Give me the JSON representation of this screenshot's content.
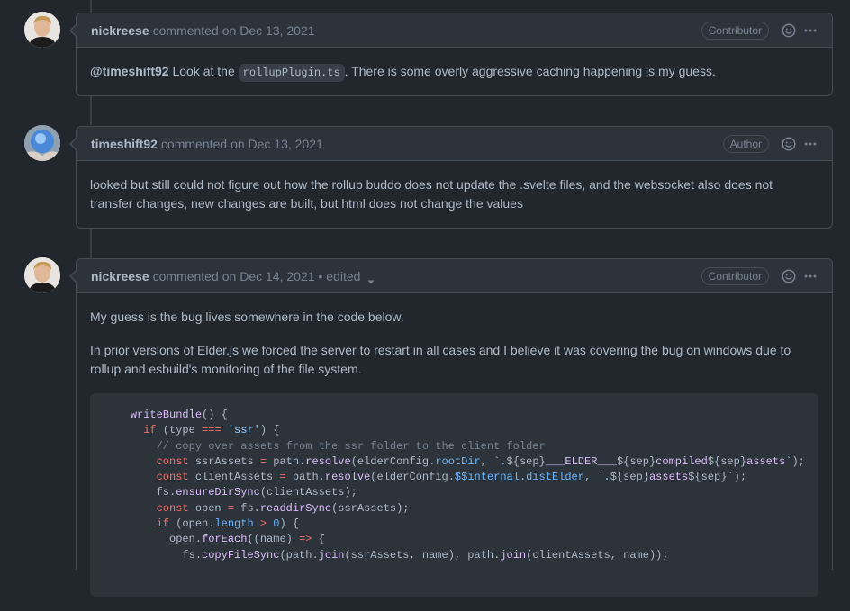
{
  "comments": [
    {
      "author": "nickreese",
      "action": "commented",
      "date": "on Dec 13, 2021",
      "badge": "Contributor",
      "body": {
        "mention": "@timeshift92",
        "text_before_code": " Look at the ",
        "code": "rollupPlugin.ts",
        "text_after_code": ". There is some overly aggressive caching happening is my guess."
      }
    },
    {
      "author": "timeshift92",
      "action": "commented",
      "date": "on Dec 13, 2021",
      "badge": "Author",
      "body": {
        "text": "looked but still could not figure out how the rollup buddo does not update the .svelte files, and the websocket also does not transfer changes, new changes are built, but html does not change the values"
      }
    },
    {
      "author": "nickreese",
      "action": "commented",
      "date": "on Dec 14, 2021",
      "edited": "• edited",
      "badge": "Contributor",
      "body": {
        "p1": "My guess is the bug lives somewhere in the code below.",
        "p2": "In prior versions of Elder.js we forced the server to restart in all cases and I believe it was covering the bug on windows due to rollup and esbuild's monitoring of the file system."
      }
    }
  ],
  "code_lines": [
    "    writeBundle() {",
    "      if (type === 'ssr') {",
    "        // copy over assets from the ssr folder to the client folder",
    "        const ssrAssets = path.resolve(elderConfig.rootDir, `.${sep}___ELDER___${sep}compiled${sep}assets`);",
    "        const clientAssets = path.resolve(elderConfig.$$internal.distElder, `.${sep}assets${sep}`);",
    "        fs.ensureDirSync(clientAssets);",
    "        const open = fs.readdirSync(ssrAssets);",
    "        if (open.length > 0) {",
    "          open.forEach((name) => {",
    "            fs.copyFileSync(path.join(ssrAssets, name), path.join(clientAssets, name));"
  ],
  "icons": {
    "emoji": "smiley-icon",
    "menu": "kebab-horizontal-icon",
    "edited_dropdown": "triangle-down-icon"
  },
  "colors": {
    "background": "#22272e",
    "header": "#2d333b",
    "border": "#444c56",
    "text": "#adbac7",
    "muted": "#768390"
  }
}
